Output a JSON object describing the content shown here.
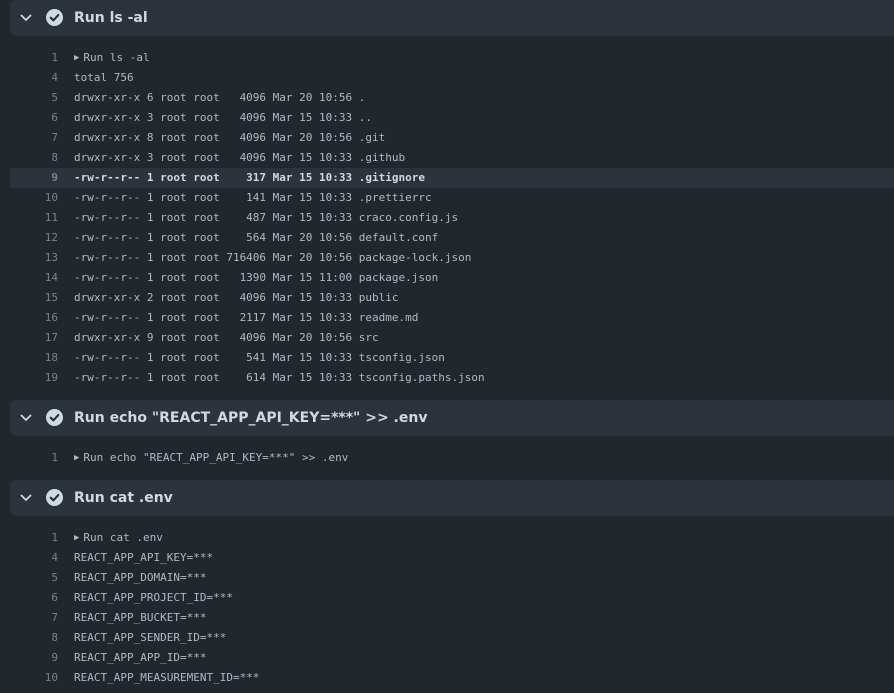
{
  "steps": [
    {
      "title": "Run ls -al",
      "lines": [
        {
          "n": "1",
          "t": "Run ls -al",
          "toggle": true
        },
        {
          "n": "4",
          "t": "total 756"
        },
        {
          "n": "5",
          "t": "drwxr-xr-x 6 root root   4096 Mar 20 10:56 ."
        },
        {
          "n": "6",
          "t": "drwxr-xr-x 3 root root   4096 Mar 15 10:33 .."
        },
        {
          "n": "7",
          "t": "drwxr-xr-x 8 root root   4096 Mar 20 10:56 .git"
        },
        {
          "n": "8",
          "t": "drwxr-xr-x 3 root root   4096 Mar 15 10:33 .github"
        },
        {
          "n": "9",
          "t": "-rw-r--r-- 1 root root    317 Mar 15 10:33 .gitignore",
          "highlight": true
        },
        {
          "n": "10",
          "t": "-rw-r--r-- 1 root root    141 Mar 15 10:33 .prettierrc"
        },
        {
          "n": "11",
          "t": "-rw-r--r-- 1 root root    487 Mar 15 10:33 craco.config.js"
        },
        {
          "n": "12",
          "t": "-rw-r--r-- 1 root root    564 Mar 20 10:56 default.conf"
        },
        {
          "n": "13",
          "t": "-rw-r--r-- 1 root root 716406 Mar 20 10:56 package-lock.json"
        },
        {
          "n": "14",
          "t": "-rw-r--r-- 1 root root   1390 Mar 15 11:00 package.json"
        },
        {
          "n": "15",
          "t": "drwxr-xr-x 2 root root   4096 Mar 15 10:33 public"
        },
        {
          "n": "16",
          "t": "-rw-r--r-- 1 root root   2117 Mar 15 10:33 readme.md"
        },
        {
          "n": "17",
          "t": "drwxr-xr-x 9 root root   4096 Mar 20 10:56 src"
        },
        {
          "n": "18",
          "t": "-rw-r--r-- 1 root root    541 Mar 15 10:33 tsconfig.json"
        },
        {
          "n": "19",
          "t": "-rw-r--r-- 1 root root    614 Mar 15 10:33 tsconfig.paths.json"
        }
      ]
    },
    {
      "title": "Run echo \"REACT_APP_API_KEY=***\" >> .env",
      "lines": [
        {
          "n": "1",
          "t": "Run echo \"REACT_APP_API_KEY=***\" >> .env",
          "toggle": true
        }
      ]
    },
    {
      "title": "Run cat .env",
      "lines": [
        {
          "n": "1",
          "t": "Run cat .env",
          "toggle": true
        },
        {
          "n": "4",
          "t": "REACT_APP_API_KEY=***"
        },
        {
          "n": "5",
          "t": "REACT_APP_DOMAIN=***"
        },
        {
          "n": "6",
          "t": "REACT_APP_PROJECT_ID=***"
        },
        {
          "n": "7",
          "t": "REACT_APP_BUCKET=***"
        },
        {
          "n": "8",
          "t": "REACT_APP_SENDER_ID=***"
        },
        {
          "n": "9",
          "t": "REACT_APP_APP_ID=***"
        },
        {
          "n": "10",
          "t": "REACT_APP_MEASUREMENT_ID=***"
        }
      ]
    }
  ],
  "icons": {
    "chevron": "chevron-down-icon",
    "check": "check-circle-icon",
    "toggle": "triangle-right-icon"
  },
  "colors": {
    "background": "#22272e",
    "header": "#2d333b",
    "text": "#adbac7",
    "line_number": "#768390",
    "check": "#cdd9e5"
  }
}
